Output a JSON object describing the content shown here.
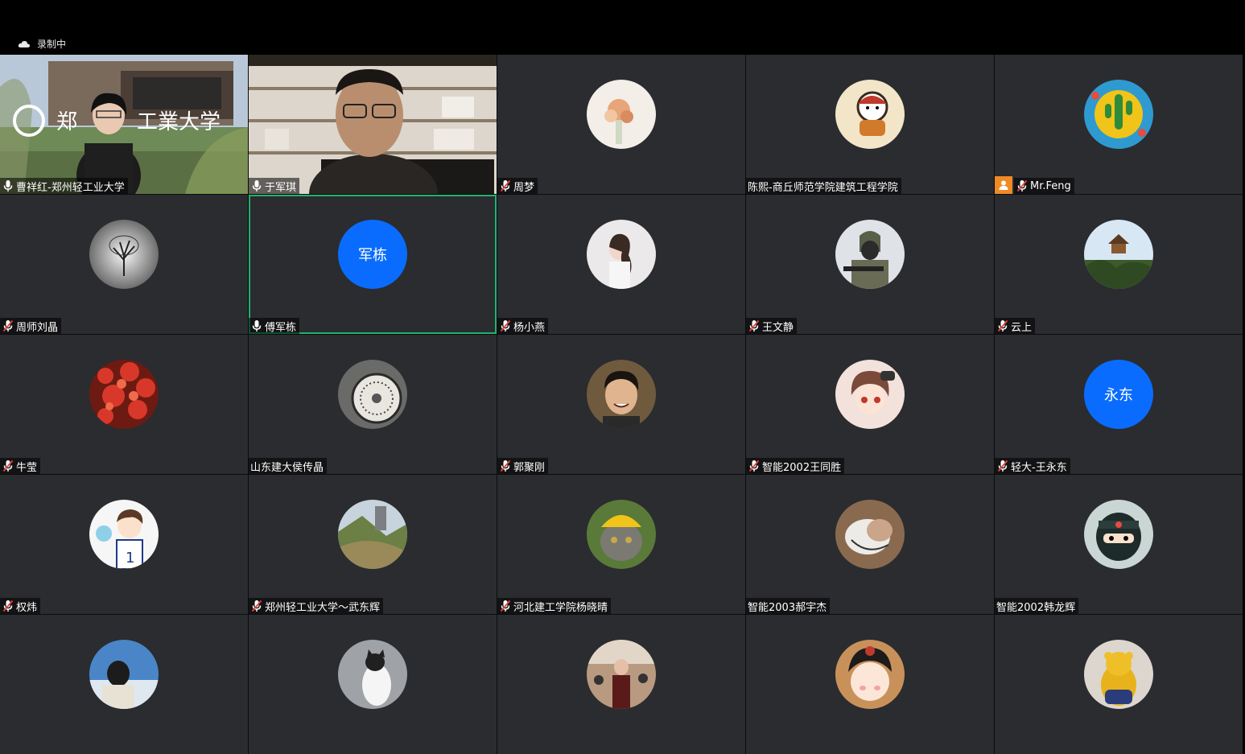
{
  "recording": {
    "text": "录制中"
  },
  "colors": {
    "tile_bg": "#2a2c30",
    "active_border": "#1fb36b",
    "initials_bg": "#0a6cff",
    "host_badge": "#f08a24"
  },
  "participants": [
    {
      "name": "曹祥红-郑州轻工业大学",
      "mic": "on",
      "kind": "video-campus"
    },
    {
      "name": "于军琪",
      "mic": "on",
      "kind": "video-office"
    },
    {
      "name": "周梦",
      "mic": "muted",
      "avatar_icon": "flowers-avatar"
    },
    {
      "name": "陈熙-商丘师范学院建筑工程学院",
      "mic": "none",
      "avatar_icon": "cartoon-avatar"
    },
    {
      "name": "Mr.Feng",
      "mic": "muted",
      "avatar_icon": "cactus-avatar",
      "host": true
    },
    {
      "name": "周师刘晶",
      "mic": "muted",
      "avatar_icon": "tree-avatar"
    },
    {
      "name": "傅军栋",
      "mic": "on",
      "initials": "军栋",
      "active": true
    },
    {
      "name": "杨小燕",
      "mic": "muted",
      "avatar_icon": "girl-avatar"
    },
    {
      "name": "王文静",
      "mic": "muted",
      "avatar_icon": "soldier-avatar"
    },
    {
      "name": "云上",
      "mic": "muted",
      "avatar_icon": "pavilion-avatar"
    },
    {
      "name": "牛莹",
      "mic": "muted",
      "avatar_icon": "red-leaves-avatar"
    },
    {
      "name": "山东建大侯传晶",
      "mic": "none",
      "avatar_icon": "dial-avatar"
    },
    {
      "name": "郭聚刚",
      "mic": "muted",
      "avatar_icon": "smiling-man-avatar"
    },
    {
      "name": "智能2002王同胜",
      "mic": "muted",
      "avatar_icon": "anime-girl-avatar"
    },
    {
      "name": "轻大-王永东",
      "mic": "muted",
      "initials": "永东"
    },
    {
      "name": "权炜",
      "mic": "muted",
      "avatar_icon": "basketball-boy-avatar"
    },
    {
      "name": "郑州轻工业大学～武东辉",
      "mic": "muted",
      "avatar_icon": "hillside-avatar"
    },
    {
      "name": "河北建工学院杨晓晴",
      "mic": "muted",
      "avatar_icon": "cat-hat-avatar"
    },
    {
      "name": "智能2003郝宇杰",
      "mic": "none",
      "avatar_icon": "sleeping-cat-avatar"
    },
    {
      "name": "智能2002韩龙辉",
      "mic": "none",
      "avatar_icon": "ninja-avatar"
    },
    {
      "name": "",
      "mic": "none",
      "avatar_icon": "sky-person-avatar"
    },
    {
      "name": "",
      "mic": "none",
      "avatar_icon": "white-cat-avatar"
    },
    {
      "name": "",
      "mic": "none",
      "avatar_icon": "street-woman-avatar"
    },
    {
      "name": "",
      "mic": "none",
      "avatar_icon": "chibi-girl-avatar"
    },
    {
      "name": "",
      "mic": "none",
      "avatar_icon": "bear-toy-avatar"
    }
  ]
}
